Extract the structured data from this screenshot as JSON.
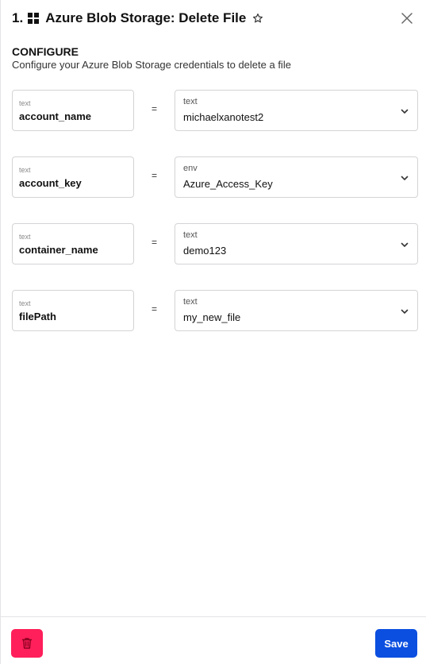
{
  "header": {
    "step_number": "1.",
    "title": "Azure Blob Storage: Delete File",
    "app_icon": "windows-grid-icon",
    "star_icon": "star-icon",
    "close_icon": "close-icon"
  },
  "configure": {
    "title": "CONFIGURE",
    "description": "Configure your Azure Blob Storage credentials to delete a file"
  },
  "params": [
    {
      "key_type": "text",
      "key": "account_name",
      "equals": "=",
      "value_type": "text",
      "value": "michaelxanotest2"
    },
    {
      "key_type": "text",
      "key": "account_key",
      "equals": "=",
      "value_type": "env",
      "value": "Azure_Access_Key"
    },
    {
      "key_type": "text",
      "key": "container_name",
      "equals": "=",
      "value_type": "text",
      "value": "demo123"
    },
    {
      "key_type": "text",
      "key": "filePath",
      "equals": "=",
      "value_type": "text",
      "value": "my_new_file"
    }
  ],
  "footer": {
    "delete_icon": "trash-icon",
    "save_label": "Save"
  },
  "colors": {
    "delete": "#ff1f5a",
    "save": "#0b4fe0",
    "border": "#d4d4d8"
  }
}
